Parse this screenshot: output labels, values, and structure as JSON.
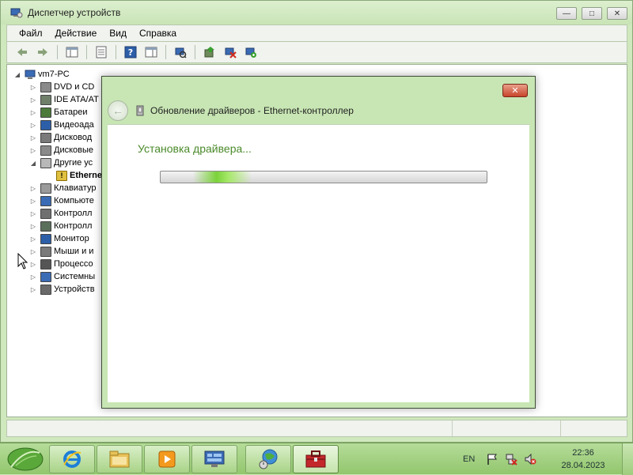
{
  "window": {
    "title": "Диспетчер устройств",
    "controls": {
      "minimize": "—",
      "maximize": "□",
      "close": "✕"
    }
  },
  "menu": [
    "Файл",
    "Действие",
    "Вид",
    "Справка"
  ],
  "toolbar": {
    "icons": [
      "back-icon",
      "forward-icon",
      "show-hide-tree-icon",
      "properties-icon",
      "help-icon",
      "action-pane-icon",
      "scan-hardware-icon",
      "update-driver-icon",
      "disable-device-icon",
      "uninstall-device-icon"
    ]
  },
  "tree": {
    "root": "vm7-PC",
    "items": [
      {
        "label": "DVD и CD",
        "expander": "▷",
        "icon_color": "#8a8a8a"
      },
      {
        "label": "IDE ATA/AT",
        "expander": "▷",
        "icon_color": "#6f7f6a"
      },
      {
        "label": "Батареи",
        "expander": "▷",
        "icon_color": "#4c7a3a"
      },
      {
        "label": "Видеоада",
        "expander": "▷",
        "icon_color": "#2d5fa8"
      },
      {
        "label": "Дисковод",
        "expander": "▷",
        "icon_color": "#7a7a7a"
      },
      {
        "label": "Дисковые",
        "expander": "▷",
        "icon_color": "#8a8a8a"
      },
      {
        "label": "Другие ус",
        "expander": "◢",
        "icon_color": "#b8b8b8"
      },
      {
        "label": "Etherne",
        "child": true,
        "icon_color": "#e0c040"
      },
      {
        "label": "Клавиатур",
        "expander": "▷",
        "icon_color": "#9a9a9a"
      },
      {
        "label": "Компьюте",
        "expander": "▷",
        "icon_color": "#3a6bb5"
      },
      {
        "label": "Контролл",
        "expander": "▷",
        "icon_color": "#707070"
      },
      {
        "label": "Контролл",
        "expander": "▷",
        "icon_color": "#5a6f5a"
      },
      {
        "label": "Монитор",
        "expander": "▷",
        "icon_color": "#2d5fa8"
      },
      {
        "label": "Мыши и и",
        "expander": "▷",
        "icon_color": "#7a7a7a"
      },
      {
        "label": "Процессо",
        "expander": "▷",
        "icon_color": "#555555"
      },
      {
        "label": "Системны",
        "expander": "▷",
        "icon_color": "#3a6bb5"
      },
      {
        "label": "Устройств",
        "expander": "▷",
        "icon_color": "#6a6a6a"
      }
    ]
  },
  "dialog": {
    "title": "Обновление драйверов - Ethernet-контроллер",
    "close": "✕",
    "back": "←",
    "heading": "Установка драйвера...",
    "accent": "#4a8a2a",
    "progress": {
      "mode": "indeterminate",
      "glow_position": 0.1
    }
  },
  "taskbar": {
    "apps": [
      "internet-explorer-icon",
      "windows-explorer-icon",
      "media-player-icon",
      "control-panel-icon",
      "network-globe-icon",
      "toolbox-icon"
    ],
    "tray": {
      "lang": "EN",
      "icons": [
        "action-center-flag-icon",
        "network-icon",
        "volume-muted-icon"
      ]
    },
    "clock": {
      "time": "22:36",
      "date": "28.04.2023"
    }
  },
  "colors": {
    "theme": "#c8e6b4",
    "taskbar": "#a9d387"
  }
}
